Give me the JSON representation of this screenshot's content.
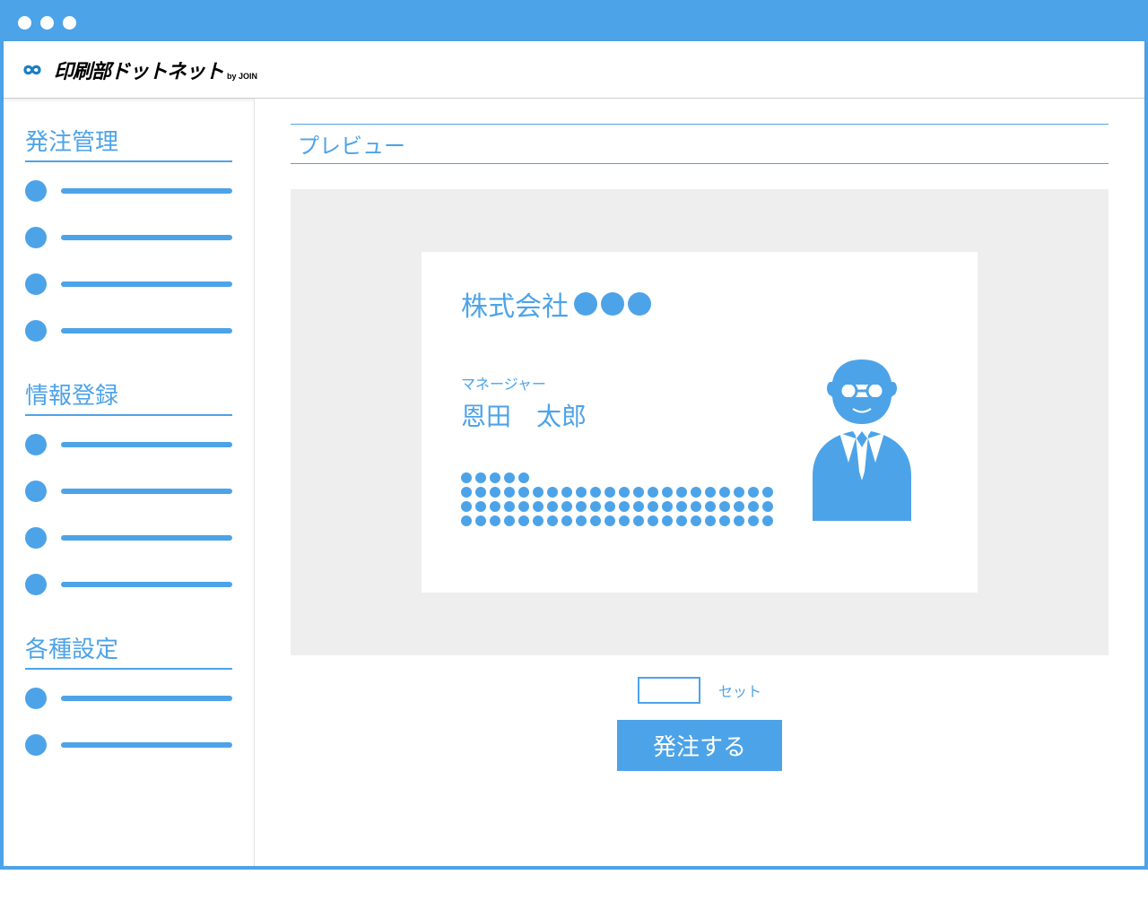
{
  "brand": {
    "name": "印刷部ドットネット",
    "sub": "by JOIN"
  },
  "sidebar": {
    "section1_title": "発注管理",
    "section1_items": 4,
    "section2_title": "情報登録",
    "section2_items": 4,
    "section3_title": "各種設定",
    "section3_items": 2
  },
  "main": {
    "title": "プレビュー",
    "card": {
      "company_prefix": "株式会社",
      "role": "マネージャー",
      "name": "恩田　太郎"
    },
    "set_label": "セット",
    "order_button": "発注する"
  },
  "colors": {
    "primary": "#4DA3E8"
  }
}
